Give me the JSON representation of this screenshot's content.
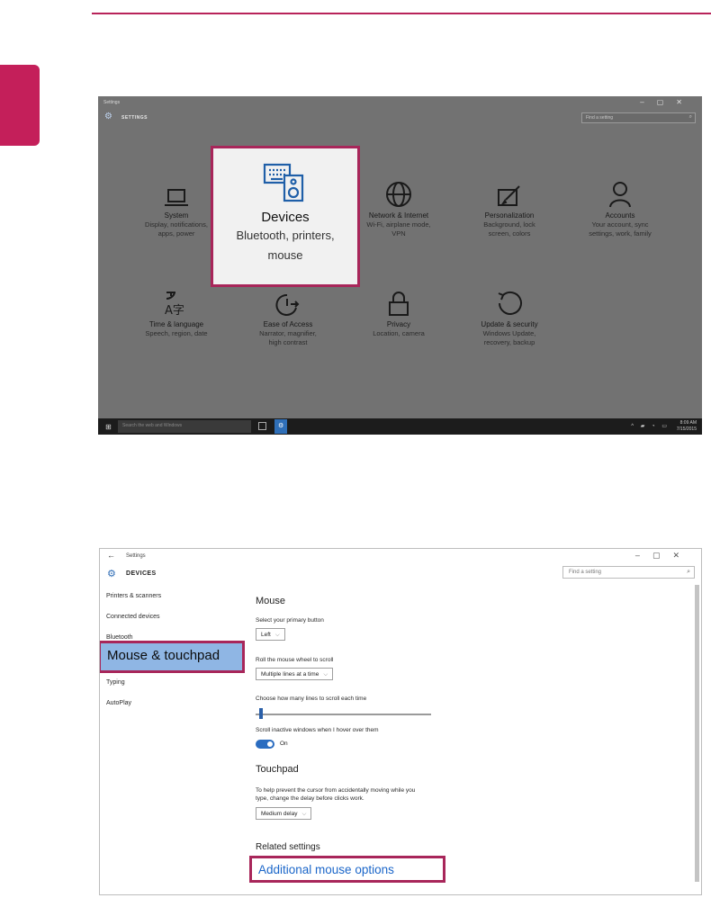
{
  "page": {
    "accent": "#b8235a"
  },
  "screenshot1": {
    "window_title": "Settings",
    "window_controls": [
      "–",
      "▢",
      "✕"
    ],
    "header": "SETTINGS",
    "search_placeholder": "Find a setting",
    "tiles": [
      {
        "title": "System",
        "desc": [
          "Display, notifications,",
          "apps, power"
        ],
        "icon": "laptop-icon"
      },
      {
        "title": "Devices",
        "desc": [
          "Bluetooth, printers,",
          "mouse"
        ],
        "icon": "keyboard-speaker-icon",
        "highlighted": true
      },
      {
        "title": "Network & Internet",
        "desc": [
          "Wi-Fi, airplane mode,",
          "VPN"
        ],
        "icon": "globe-icon"
      },
      {
        "title": "Personalization",
        "desc": [
          "Background, lock",
          "screen, colors"
        ],
        "icon": "paint-icon"
      },
      {
        "title": "Accounts",
        "desc": [
          "Your account, sync",
          "settings, work, family"
        ],
        "icon": "person-icon"
      },
      {
        "title": "Time & language",
        "desc": [
          "Speech, region, date"
        ],
        "icon": "language-icon"
      },
      {
        "title": "Ease of Access",
        "desc": [
          "Narrator, magnifier,",
          "high contrast"
        ],
        "icon": "ease-of-access-icon"
      },
      {
        "title": "Privacy",
        "desc": [
          "Location, camera"
        ],
        "icon": "lock-icon"
      },
      {
        "title": "Update & security",
        "desc": [
          "Windows Update,",
          "recovery, backup"
        ],
        "icon": "refresh-icon"
      }
    ],
    "taskbar": {
      "search_placeholder": "Search the web and Windows",
      "time": "8:09 AM",
      "date": "7/15/2015"
    }
  },
  "screenshot2": {
    "window_title": "Settings",
    "back": "←",
    "window_controls": [
      "–",
      "▢",
      "✕"
    ],
    "header": "DEVICES",
    "search_placeholder": "Find a setting",
    "sidebar": [
      "Printers & scanners",
      "Connected devices",
      "Bluetooth",
      "Mouse & touchpad",
      "Typing",
      "AutoPlay"
    ],
    "mouse": {
      "heading": "Mouse",
      "primary_label": "Select your primary button",
      "primary_value": "Left",
      "wheel_label": "Roll the mouse wheel to scroll",
      "wheel_value": "Multiple lines at a time",
      "lines_label": "Choose how many lines to scroll each time",
      "lines_level": 0.02,
      "inactive_label": "Scroll inactive windows when I hover over them",
      "inactive_state": "On"
    },
    "touchpad": {
      "heading": "Touchpad",
      "delay_label_1": "To help prevent the cursor from accidentally moving while you",
      "delay_label_2": "type, change the delay before clicks work.",
      "delay_value": "Medium delay"
    },
    "related": {
      "heading": "Related settings",
      "link": "Additional mouse options"
    }
  }
}
